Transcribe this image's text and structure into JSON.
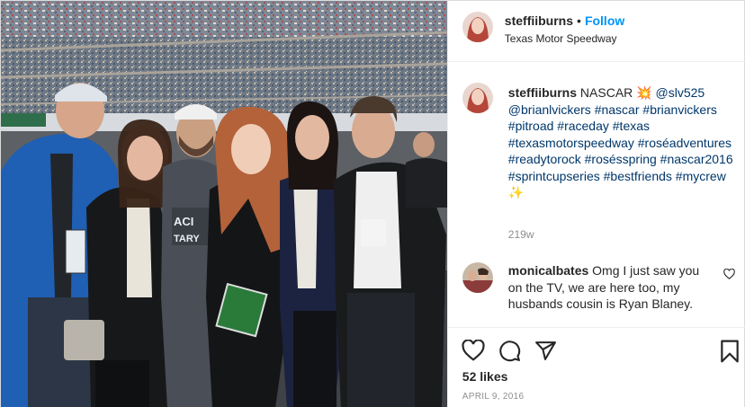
{
  "post": {
    "username": "steffiiburns",
    "follow_label": "Follow",
    "dot": "•",
    "location": "Texas Motor Speedway"
  },
  "caption": {
    "username": "steffiiburns",
    "text_prefix": "NASCAR",
    "emoji": "💥",
    "mentions": [
      "@slv525",
      "@brianlvickers"
    ],
    "hashtags": [
      "#nascar",
      "#brianvickers",
      "#pitroad",
      "#raceday",
      "#texas",
      "#texasmotorspeedway",
      "#roséadventures",
      "#readytorock",
      "#rosésspring",
      "#nascar2016",
      "#sprintcupseries",
      "#bestfriends",
      "#mycrew"
    ],
    "trailing_emoji": "✨",
    "time": "219w"
  },
  "comment": {
    "username": "monicalbates",
    "text": "Omg I just saw you on the TV, we are here too, my husbands cousin is Ryan Blaney."
  },
  "actions": {
    "likes": "52 likes",
    "date": "APRIL 9, 2016"
  },
  "icons": {
    "like": "heart-icon",
    "comment": "comment-icon",
    "share": "share-icon",
    "save": "bookmark-icon",
    "comment_like": "heart-icon"
  },
  "colors": {
    "follow": "#0095f6",
    "link": "#00376b",
    "muted": "#8e8e8e"
  }
}
